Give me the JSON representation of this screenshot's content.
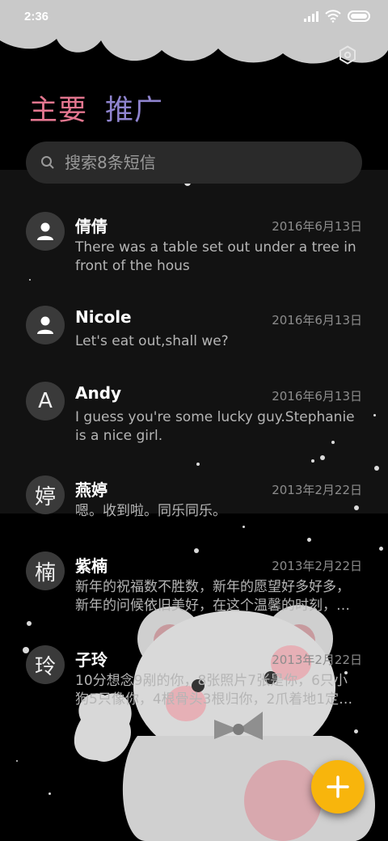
{
  "status_bar": {
    "time": "2:36"
  },
  "tabs": {
    "primary": "主要",
    "secondary": "推广"
  },
  "search": {
    "placeholder": "搜索8条短信"
  },
  "conversations": [
    {
      "avatar_type": "person-icon",
      "avatar_text": "",
      "name": "倩倩",
      "date": "2016年6月13日",
      "preview": "There was a table set out under a tree in front of the hous"
    },
    {
      "avatar_type": "person-icon",
      "avatar_text": "",
      "name": "Nicole",
      "date": "2016年6月13日",
      "preview": "Let's eat out,shall we?"
    },
    {
      "avatar_type": "letter",
      "avatar_text": "A",
      "name": "Andy",
      "date": "2016年6月13日",
      "preview": "I guess you're some lucky guy.Stephanie is a nice girl."
    },
    {
      "avatar_type": "letter",
      "avatar_text": "婷",
      "name": "燕婷",
      "date": "2013年2月22日",
      "preview": "嗯。收到啦。同乐同乐。"
    },
    {
      "avatar_type": "letter",
      "avatar_text": "楠",
      "name": "紫楠",
      "date": "2013年2月22日",
      "preview": "新年的祝福数不胜数，新年的愿望好多好多，新年的问候依旧美好，在这个温馨的时刻，…"
    },
    {
      "avatar_type": "letter",
      "avatar_text": "玲",
      "name": "子玲",
      "date": "2013年2月22日",
      "preview": "10分想念9剐的你，8张照片7张是你，6只小狗5只像你，4根骨头3根归你，2爪着地1定…"
    }
  ],
  "colors": {
    "tab_active": "#e3768f",
    "tab_other": "#8f84cf",
    "fab": "#f8b50c"
  },
  "icons": {
    "settings": "settings-icon",
    "search": "search-icon",
    "fab": "plus-icon"
  }
}
